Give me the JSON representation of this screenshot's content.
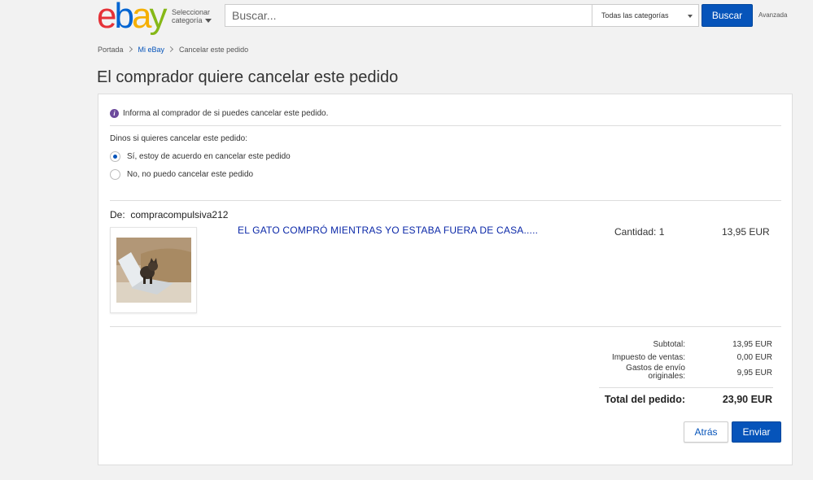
{
  "header": {
    "logo": {
      "e": "e",
      "b": "b",
      "a": "a",
      "y": "y"
    },
    "category_link": {
      "line1": "Seleccionar",
      "line2": "categoría"
    },
    "search": {
      "placeholder": "Buscar...",
      "value": ""
    },
    "category_dropdown": "Todas las categorías",
    "search_button": "Buscar",
    "advanced_link": "Avanzada"
  },
  "breadcrumb": [
    "Portada",
    "Mi eBay",
    "Cancelar este pedido"
  ],
  "page_title": "El comprador quiere cancelar este pedido",
  "info_message": "Informa al comprador de si puedes cancelar este pedido.",
  "question": "Dinos si quieres cancelar este pedido:",
  "options": [
    {
      "label": "Sí, estoy de acuerdo en cancelar este pedido",
      "selected": true
    },
    {
      "label": "No, no puedo cancelar este pedido",
      "selected": false
    }
  ],
  "order": {
    "from_label": "De:",
    "buyer": "compracompulsiva212",
    "item_title": "EL GATO COMPRÓ MIENTRAS YO ESTABA FUERA DE CASA.....",
    "quantity": "Cantidad: 1",
    "price": "13,95 EUR"
  },
  "summary": {
    "subtotal_label": "Subtotal:",
    "subtotal_value": "13,95 EUR",
    "tax_label": "Impuesto de ventas:",
    "tax_value": "0,00 EUR",
    "shipping_label_line1": "Gastos de envío",
    "shipping_label_line2": "originales:",
    "shipping_value": "9,95 EUR",
    "total_label": "Total del pedido:",
    "total_value": "23,90 EUR"
  },
  "buttons": {
    "back": "Atrás",
    "send": "Enviar"
  },
  "colors": {
    "accent": "#0654ba",
    "item_link": "#0b28a8",
    "info_icon": "#6c4a9c"
  }
}
